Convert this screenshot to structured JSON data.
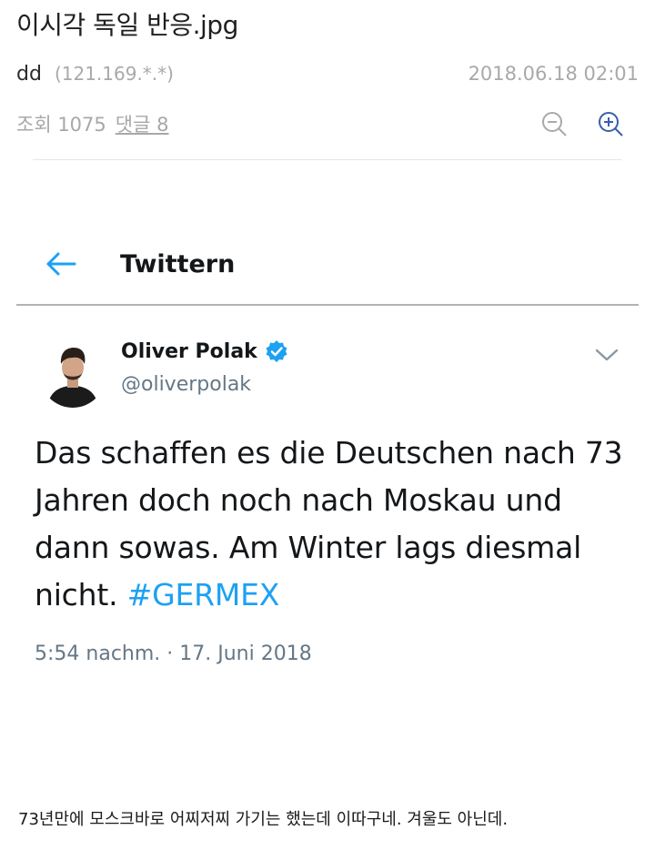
{
  "post": {
    "title": "이시각 독일 반응.jpg",
    "author": "dd",
    "ip": "(121.169.*.*)",
    "date": "2018.06.18 02:01",
    "views_label": "조회 1075",
    "comments_label": "댓글 8"
  },
  "tweet": {
    "header_title": "Twittern",
    "name": "Oliver Polak",
    "handle": "@oliverpolak",
    "text": "Das schaffen es die Deutschen nach 73 Jahren doch noch nach Moskau und dann sowas. Am Winter lags diesmal nicht. ",
    "hashtag": "#GERMEX",
    "timestamp": "5:54 nachm. · 17. Juni 2018"
  },
  "caption": "73년만에 모스크바로 어찌저찌 가기는 했는데 이따구네. 겨울도 아닌데.",
  "colors": {
    "twitter_blue": "#1da1f2",
    "meta_gray": "#a9a9a9",
    "handle_gray": "#657786"
  },
  "icons": [
    "zoom-out-icon",
    "zoom-in-icon",
    "back-arrow-icon",
    "verified-badge-icon",
    "chevron-down-icon"
  ]
}
